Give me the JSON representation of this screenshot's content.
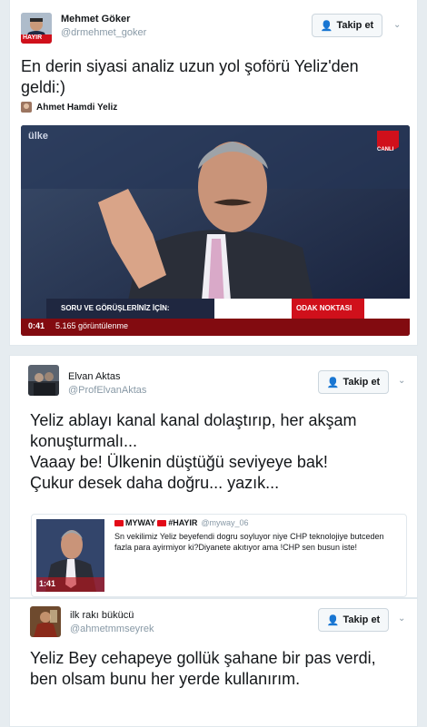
{
  "tweet1": {
    "author_name": "Mehmet Göker",
    "author_handle": "@drmehmet_goker",
    "follow_label": "Takip et",
    "text": "En derin siyasi analiz uzun yol şoförü Yeliz'den geldi:)",
    "mention_name": "Ahmet Hamdi Yeliz",
    "avatar_badge": "HAYIR",
    "video": {
      "channel_logo": "ülke",
      "live_label": "CANLI",
      "lower_third_left": "SORU VE GÖRÜŞLERİNİZ İÇİN:",
      "lower_third_right": "ODAK NOKTASI",
      "duration": "0:41",
      "views": "5.165 görüntülenme"
    }
  },
  "tweet2": {
    "author_name": "Elvan Aktas",
    "author_handle": "@ProfElvanAktas",
    "follow_label": "Takip et",
    "text": "Yeliz ablayı kanal kanal dolaştırıp, her akşam konuşturmalı...\nVaaay be! Ülkenin düştüğü seviyeye bak!\nÇukur desek daha doğru... yazık...",
    "quote": {
      "author_name": "MYWAY",
      "author_name_suffix": "#HAYIR",
      "author_handle": "@myway_06",
      "text": "Sn vekilimiz Yeliz beyefendi dogru soyluyor niye CHP teknolojiye butceden fazla para ayirmiyor ki?Diyanete akıtıyor ama !CHP sen busun iste!",
      "thumb_duration": "1:41"
    }
  },
  "tweet3": {
    "author_name": "ilk rakı bükücü",
    "author_handle": "@ahmetmmseyrek",
    "follow_label": "Takip et",
    "text": "Yeliz Bey cehapeye gollük şahane bir pas verdi, ben olsam bunu her yerde kullanırım."
  },
  "colors": {
    "accent": "#1da1f2",
    "channel_red": "#d0101b",
    "text": "#14171a",
    "muted": "#8899a6"
  }
}
